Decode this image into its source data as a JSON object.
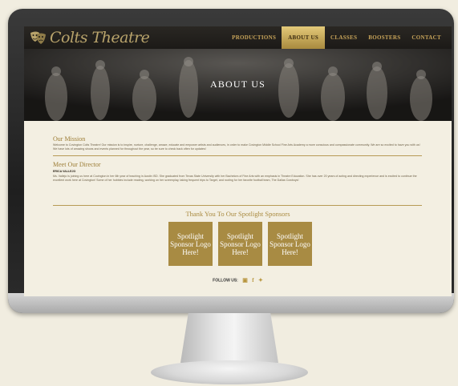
{
  "site": {
    "logo_text": "Colts Theatre",
    "accent_color": "#a88b43"
  },
  "nav": {
    "items": [
      {
        "label": "PRODUCTIONS",
        "active": false
      },
      {
        "label": "ABOUT US",
        "active": true
      },
      {
        "label": "CLASSES",
        "active": false
      },
      {
        "label": "BOOSTERS",
        "active": false
      },
      {
        "label": "CONTACT",
        "active": false
      }
    ]
  },
  "hero": {
    "title": "ABOUT US"
  },
  "mission": {
    "heading": "Our Mission",
    "text": "Welcome to Covington Colts Theatre! Our mission is to inspire, nurture, challenge, amaze, educate and empower artists and audiences, in order to make Covington Middle School Fine Arts Academy a more conscious and compassionate community. We are so excited to have you with us! We have lots of amazing shows and events planned for throughout the year, so be sure to check back often for updates!"
  },
  "director": {
    "heading": "Meet Our Director",
    "name": "ERICA VALLEJO",
    "text": "Ms. Vallejo is joining us here at Covington in her 6th year of teaching in Austin ISD. She graduated from Texas State University with her Bachelors of Fine Arts with an emphasis in Theatre Education. She has over 20 years of acting and directing experience and is excited to continue the excellent work here at Covington! Some of her hobbies include reading, working on her screenplay, taking frequent trips to Target, and rooting for her favorite football team, The Dallas Cowboys!"
  },
  "sponsors": {
    "heading": "Thank You To Our Spotlight Sponsors",
    "items": [
      "Spotlight Sponsor Logo Here!",
      "Spotlight Sponsor Logo Here!",
      "Spotlight Sponsor Logo Here!"
    ]
  },
  "footer": {
    "follow_label": "FOLLOW US:",
    "social_icons": [
      "instagram-icon",
      "facebook-icon",
      "twitter-icon"
    ]
  }
}
